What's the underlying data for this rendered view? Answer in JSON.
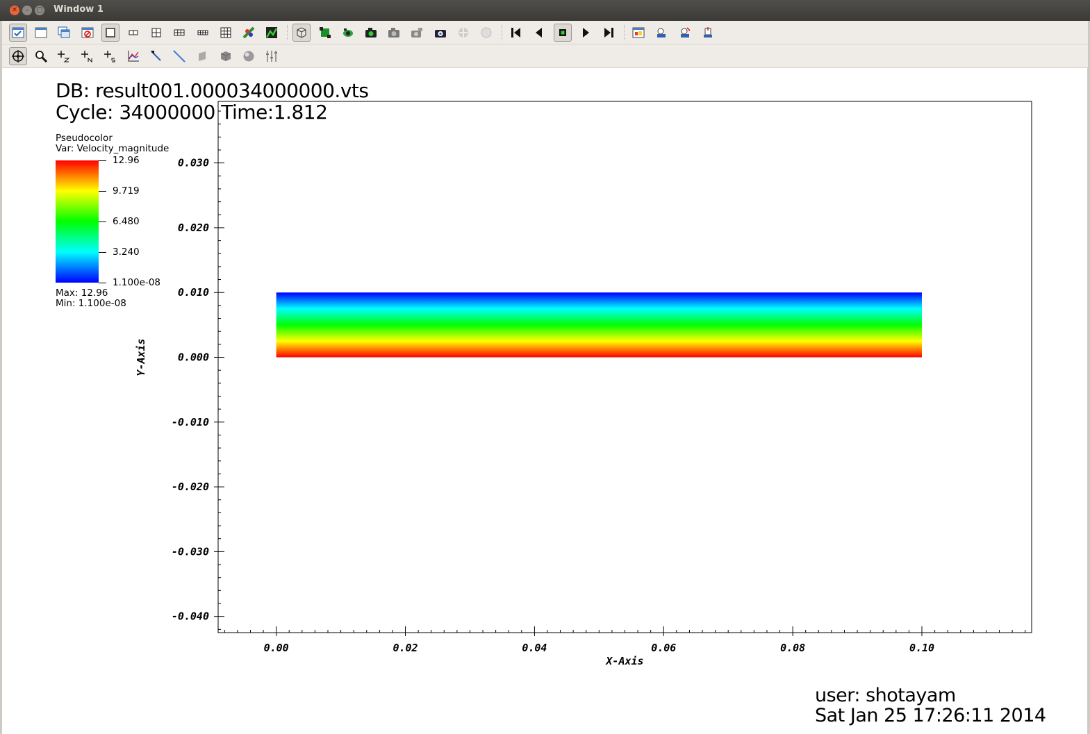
{
  "window": {
    "title": "Window 1",
    "controls": [
      "close-icon",
      "minimize-icon",
      "maximize-icon"
    ]
  },
  "toolbar1": {
    "groups": [
      [
        "active-window-icon",
        "new-window-icon",
        "clone-window-icon",
        "delete-window-icon",
        "layout-1x1-icon",
        "layout-1x2-icon",
        "layout-2x2-icon",
        "layout-2x3-icon",
        "layout-2x4-icon",
        "layout-3x3-icon",
        "lock-view-icon",
        "lock-time-icon"
      ],
      [
        "spin-icon",
        "clear-plots-icon",
        "reset-view-icon",
        "save-image-icon",
        "copy-view-icon",
        "copy-lighting-icon",
        "copy-attributes-icon",
        "lock-tools-icon",
        "globe-icon"
      ],
      [
        "reverse-step-icon",
        "play-reverse-icon",
        "stop-icon",
        "play-icon",
        "forward-step-icon"
      ],
      [
        "commands-icon",
        "save-settings-icon",
        "import-icon",
        "export-icon"
      ]
    ]
  },
  "toolbar2": {
    "items": [
      "navigate-mode-icon",
      "zoom-mode-icon",
      "zone-pick-icon",
      "node-pick-icon",
      "spreadsheet-pick-icon",
      "curve-pick-icon",
      "lineout-icon",
      "line-tool-icon",
      "plane-tool-icon",
      "box-tool-icon",
      "sphere-tool-icon",
      "sliders-icon"
    ]
  },
  "annotations": {
    "db": "DB: result001.000034000000.vts",
    "cycle": "Cycle: 34000000 Time:1.812",
    "user": "user: shotayam",
    "date": "Sat Jan 25 17:26:11 2014"
  },
  "legend": {
    "title": "Pseudocolor",
    "var": "Var: Velocity_magnitude",
    "max": "Max:  12.96",
    "min": "Min:  1.100e-08",
    "tick_labels": [
      "12.96",
      "9.719",
      "6.480",
      "3.240",
      "1.100e-08"
    ],
    "colors": [
      "#ff0000",
      "#ffff00",
      "#00ff00",
      "#00ffff",
      "#0000ff"
    ]
  },
  "chart_data": {
    "type": "heatmap",
    "xlabel": "X-Axis",
    "ylabel": "Y-Axis",
    "xlim": [
      -0.009,
      0.117
    ],
    "ylim": [
      -0.0425,
      0.0395
    ],
    "x_ticks": [
      0.0,
      0.02,
      0.04,
      0.06,
      0.08,
      0.1
    ],
    "x_tick_labels": [
      "0.00",
      "0.02",
      "0.04",
      "0.06",
      "0.08",
      "0.10"
    ],
    "y_ticks": [
      0.03,
      0.02,
      0.01,
      0.0,
      -0.01,
      -0.02,
      -0.03,
      -0.04
    ],
    "y_tick_labels": [
      "0.030",
      "0.020",
      "0.010",
      "0.000",
      "-0.010",
      "-0.020",
      "-0.030",
      "-0.040"
    ],
    "field": {
      "x_range": [
        0.0,
        0.1
      ],
      "y_range": [
        0.0,
        0.01
      ],
      "values_at_y": [
        {
          "y": 0.0,
          "value": 12.96
        },
        {
          "y": 0.0025,
          "value": 9.719
        },
        {
          "y": 0.005,
          "value": 6.48
        },
        {
          "y": 0.0075,
          "value": 3.24
        },
        {
          "y": 0.01,
          "value": 1.1e-08
        }
      ]
    },
    "value_range": [
      1.1e-08,
      12.96
    ],
    "grid": false,
    "legend_position": "left"
  }
}
